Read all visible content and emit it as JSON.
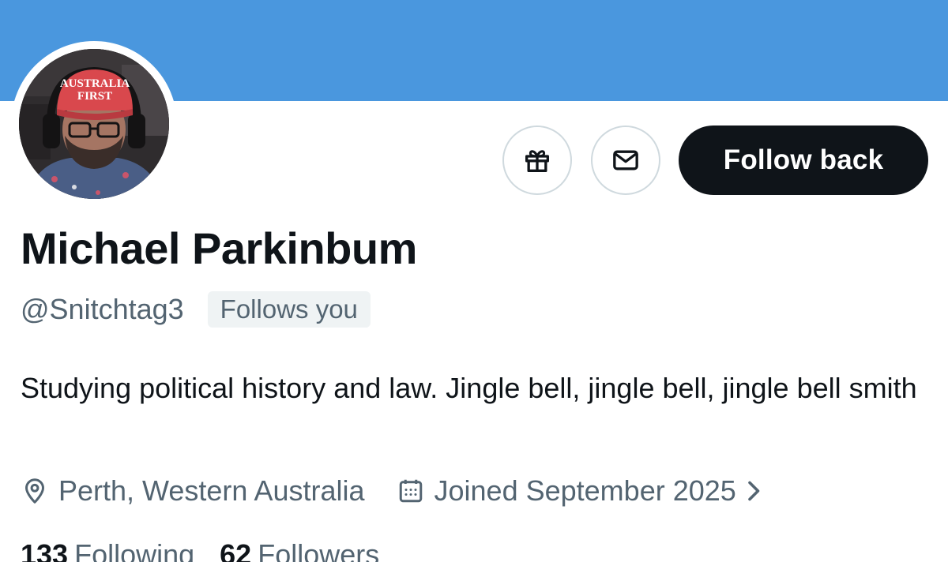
{
  "profile": {
    "hat_text_line1": "AUSTRALIA",
    "hat_text_line2": "FIRST",
    "follow_button_label": "Follow back",
    "display_name": "Michael Parkinbum",
    "handle": "@Snitchtag3",
    "follows_you_badge": "Follows you",
    "bio": "Studying political history and law. Jingle bell, jingle bell, jingle bell smith",
    "location": "Perth, Western Australia",
    "joined": "Joined September 2025",
    "following_count": "133",
    "following_label": "Following",
    "followers_count": "62",
    "followers_label": "Followers"
  },
  "icons": {
    "gift": "gift-icon",
    "message": "envelope-icon",
    "location": "location-pin-icon",
    "calendar": "calendar-icon",
    "chevron": "chevron-right-icon"
  },
  "colors": {
    "banner": "#4a97de",
    "primary_text": "#0f1419",
    "secondary_text": "#536471",
    "button_dark": "#0f1419",
    "badge_bg": "#eff3f4",
    "border": "#cfd9de",
    "hat_red": "#d9484d"
  }
}
